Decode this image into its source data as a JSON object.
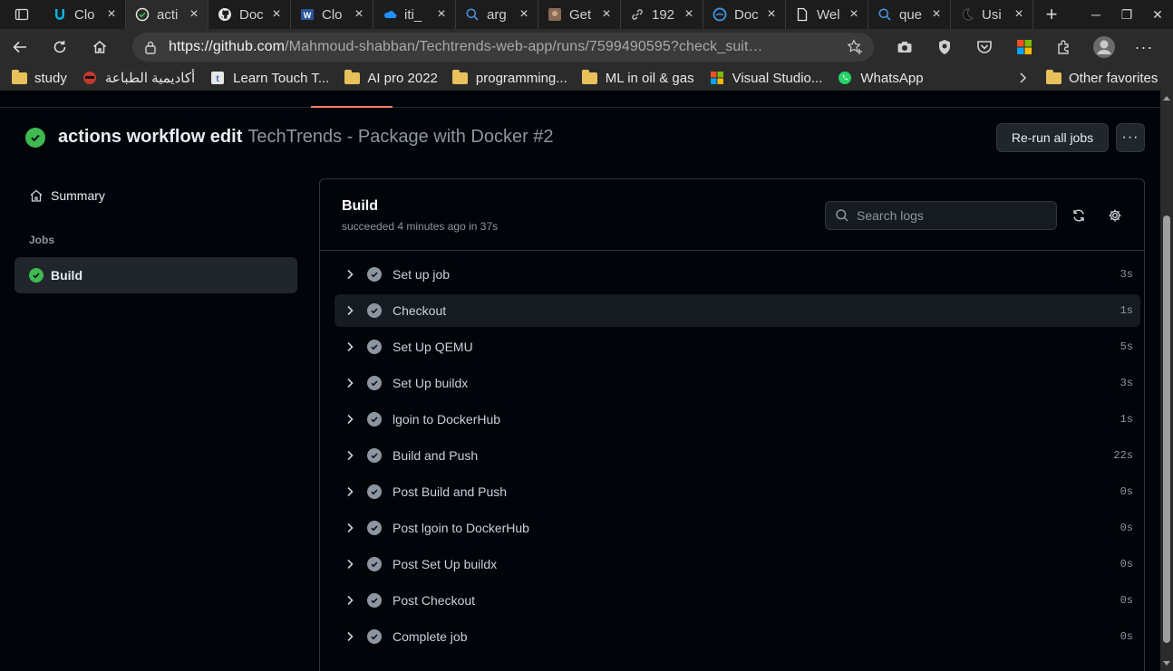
{
  "browser": {
    "tabs": [
      {
        "title": "Clo",
        "icon": "udacity-icon",
        "active": false
      },
      {
        "title": "acti",
        "icon": "github-actions-icon",
        "active": true
      },
      {
        "title": "Doc",
        "icon": "github-icon",
        "active": false
      },
      {
        "title": "Clo",
        "icon": "word-icon",
        "active": false
      },
      {
        "title": "iti_",
        "icon": "onedrive-icon",
        "active": false
      },
      {
        "title": "arg",
        "icon": "search-icon",
        "active": false
      },
      {
        "title": "Get",
        "icon": "image-icon",
        "active": false
      },
      {
        "title": "192",
        "icon": "link-icon",
        "active": false
      },
      {
        "title": "Doc",
        "icon": "edge-icon",
        "active": false
      },
      {
        "title": "Wel",
        "icon": "page-icon",
        "active": false
      },
      {
        "title": "que",
        "icon": "search-icon",
        "active": false
      },
      {
        "title": "Usi",
        "icon": "dark-icon",
        "active": false
      }
    ],
    "url_host": "https://github.com",
    "url_path": "/Mahmoud-shabban/Techtrends-web-app/runs/7599490595?check_suit…",
    "favorites": [
      {
        "label": "study",
        "icon": "folder-icon"
      },
      {
        "label": "أكاديمية الطباعة",
        "icon": "typing-icon"
      },
      {
        "label": "Learn Touch T...",
        "icon": "keyboard-icon"
      },
      {
        "label": "AI pro 2022",
        "icon": "folder-icon"
      },
      {
        "label": "programming...",
        "icon": "folder-icon"
      },
      {
        "label": "ML in oil & gas",
        "icon": "folder-icon"
      },
      {
        "label": "Visual Studio...",
        "icon": "microsoft-icon"
      },
      {
        "label": "WhatsApp",
        "icon": "whatsapp-icon"
      }
    ],
    "other_favorites": "Other favorites"
  },
  "run": {
    "workflow_name": "actions workflow edit",
    "run_name": "TechTrends - Package with Docker #2",
    "rerun_label": "Re-run all jobs",
    "more_label": "···"
  },
  "sidebar": {
    "summary_label": "Summary",
    "jobs_heading": "Jobs",
    "job_label": "Build"
  },
  "job": {
    "title": "Build",
    "status": "succeeded 4 minutes ago in 37s",
    "search_placeholder": "Search logs",
    "steps": [
      {
        "name": "Set up job",
        "duration": "3s"
      },
      {
        "name": "Checkout",
        "duration": "1s"
      },
      {
        "name": "Set Up QEMU",
        "duration": "5s"
      },
      {
        "name": "Set Up buildx",
        "duration": "3s"
      },
      {
        "name": "lgoin to DockerHub",
        "duration": "1s"
      },
      {
        "name": "Build and Push",
        "duration": "22s"
      },
      {
        "name": "Post Build and Push",
        "duration": "0s"
      },
      {
        "name": "Post lgoin to DockerHub",
        "duration": "0s"
      },
      {
        "name": "Post Set Up buildx",
        "duration": "0s"
      },
      {
        "name": "Post Checkout",
        "duration": "0s"
      },
      {
        "name": "Complete job",
        "duration": "0s"
      }
    ]
  },
  "colors": {
    "success": "#3fb950",
    "accent_underline": "#f78166",
    "page_bg": "#010409",
    "border": "#30363d"
  }
}
